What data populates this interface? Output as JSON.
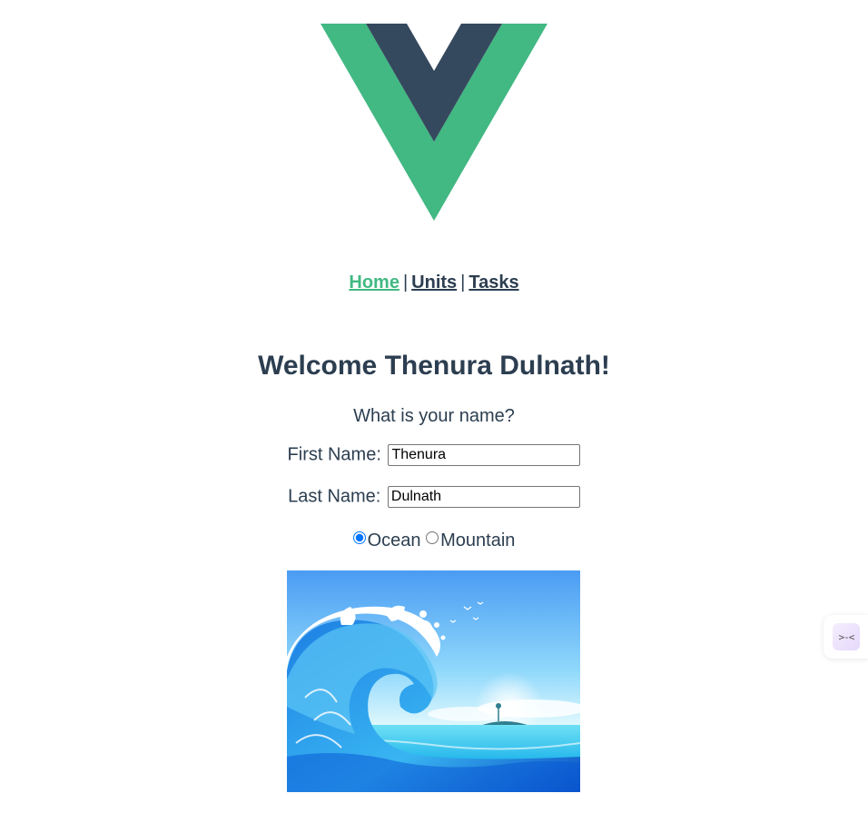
{
  "logo": {
    "icon": "vue-logo-icon",
    "outer_color": "#42b883",
    "inner_color": "#35495e"
  },
  "nav": {
    "links": [
      {
        "label": "Home",
        "active": true
      },
      {
        "label": "Units",
        "active": false
      },
      {
        "label": "Tasks",
        "active": false
      }
    ],
    "separator": "|"
  },
  "welcome": {
    "title": "Welcome Thenura Dulnath!"
  },
  "form": {
    "question": "What is your name?",
    "first_name_label": "First Name:",
    "first_name_value": "Thenura",
    "last_name_label": "Last Name:",
    "last_name_value": "Dulnath",
    "options": [
      {
        "label": "Ocean",
        "checked": true
      },
      {
        "label": "Mountain",
        "checked": false
      }
    ]
  },
  "scene": {
    "icon": "ocean-wave-image"
  },
  "widget": {
    "icon": "assistant-face-icon",
    "glyph": ">-<"
  },
  "colors": {
    "accent": "#42b983",
    "text": "#2c3e50",
    "radio": "#0075ff"
  }
}
